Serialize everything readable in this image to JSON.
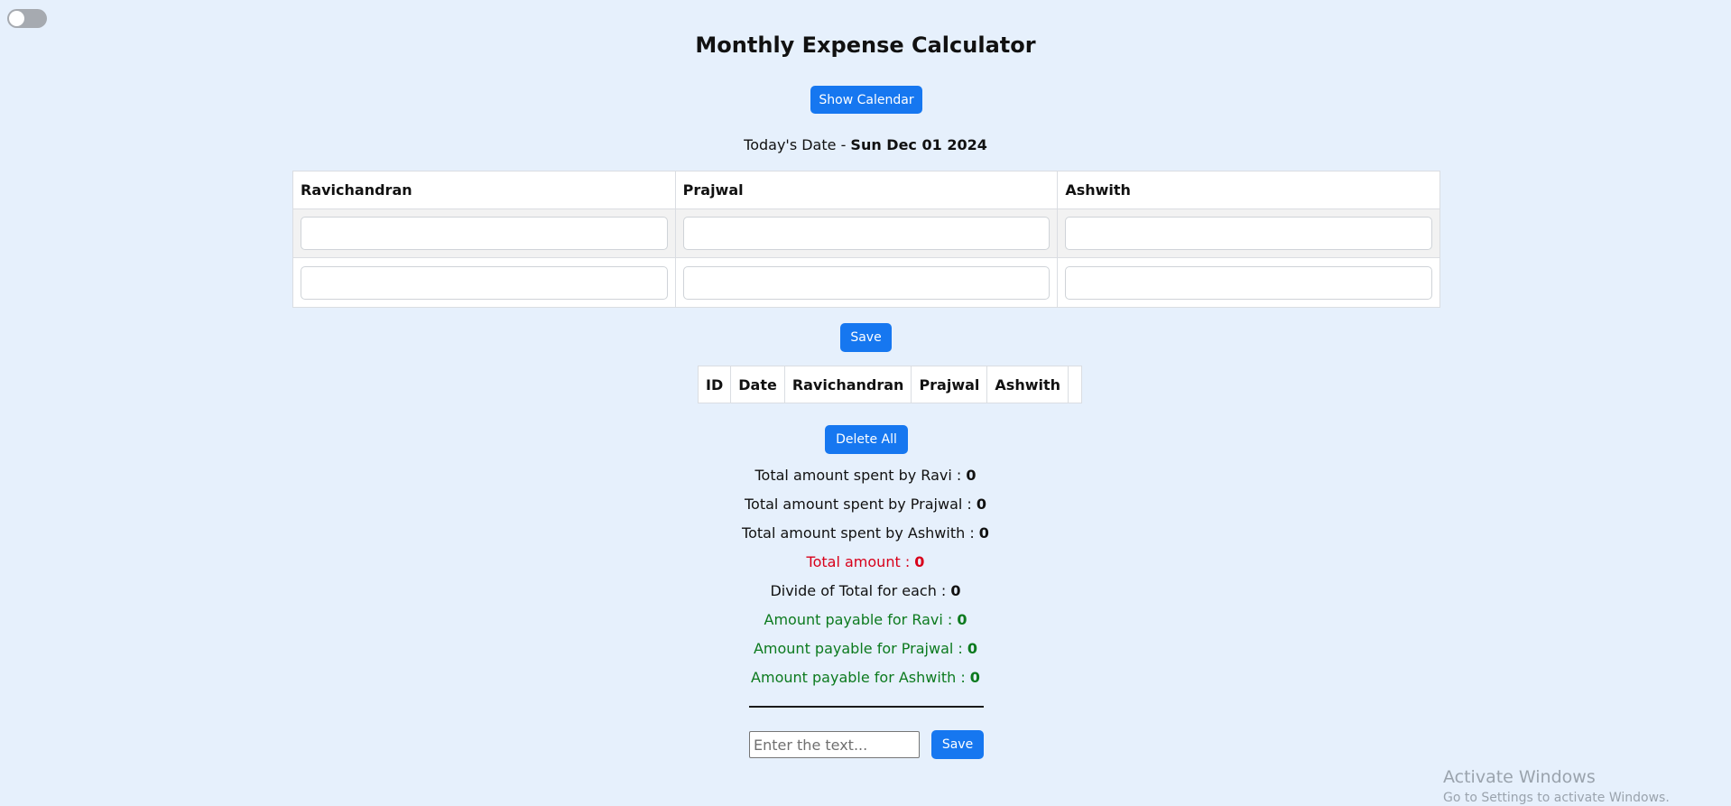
{
  "theme_toggle": {
    "state": "off"
  },
  "page_title": "Monthly Expense Calculator",
  "calendar_button": "Show Calendar",
  "today": {
    "label": "Today's Date - ",
    "value": "Sun Dec 01 2024"
  },
  "entry_table": {
    "headers": [
      "Ravichandran",
      "Prajwal",
      "Ashwith"
    ],
    "rows": [
      [
        "",
        "",
        ""
      ],
      [
        "",
        "",
        ""
      ]
    ]
  },
  "save_entries_button": "Save",
  "records_table": {
    "headers": [
      "ID",
      "Date",
      "Ravichandran",
      "Prajwal",
      "Ashwith",
      ""
    ]
  },
  "delete_all_button": "Delete All",
  "summary": {
    "ravi_total": {
      "label": "Total amount spent by Ravi : ",
      "value": "0"
    },
    "prajwal_total": {
      "label": "Total amount spent by Prajwal : ",
      "value": "0"
    },
    "ashwith_total": {
      "label": "Total amount spent by Ashwith : ",
      "value": "0"
    },
    "grand_total": {
      "label": "Total amount : ",
      "value": "0"
    },
    "divide": {
      "label": "Divide of Total for each : ",
      "value": "0"
    },
    "ravi_payable": {
      "label": "Amount payable for Ravi : ",
      "value": "0"
    },
    "prajwal_payable": {
      "label": "Amount payable for Prajwal : ",
      "value": "0"
    },
    "ashwith_payable": {
      "label": "Amount payable for Ashwith : ",
      "value": "0"
    }
  },
  "note": {
    "placeholder": "Enter the text...",
    "save_label": "Save"
  },
  "watermark": {
    "line1": "Activate Windows",
    "line2": "Go to Settings to activate Windows."
  },
  "colors": {
    "accent": "#1677f0",
    "total": "#d8001a",
    "payable": "#0c7a1e",
    "background": "#e6f0fc"
  }
}
